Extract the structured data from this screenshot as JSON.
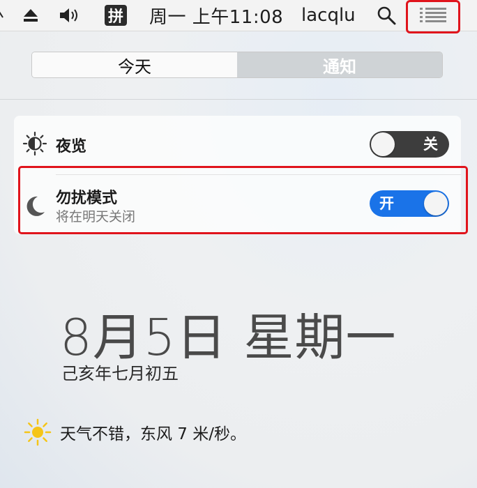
{
  "menubar": {
    "ime_label": "拼",
    "clock": "周一 上午11:08",
    "user": "lacqlu",
    "icons": {
      "edge": "chevron-edge-icon",
      "eject": "eject-icon",
      "volume": "volume-icon",
      "search": "search-icon",
      "notification_center": "list-icon"
    }
  },
  "tabs": {
    "today": "今天",
    "notifications": "通知",
    "selected": "today"
  },
  "widgets": {
    "night_shift": {
      "icon": "night-shift-sun-icon",
      "label": "夜览",
      "toggle_state": "off",
      "toggle_label": "关"
    },
    "do_not_disturb": {
      "icon": "moon-icon",
      "label": "勿扰模式",
      "subtitle": "将在明天关闭",
      "toggle_state": "on",
      "toggle_label": "开"
    }
  },
  "date": {
    "main": "8月5日 星期一",
    "lunar": "己亥年七月初五"
  },
  "weather": {
    "icon": "sun-icon",
    "text": "天气不错，东风 7 米/秒。"
  },
  "colors": {
    "toggle_on": "#1a73e8",
    "toggle_off": "#3d3d3d",
    "highlight": "#e0141c",
    "weather_sun": "#f5c518"
  }
}
